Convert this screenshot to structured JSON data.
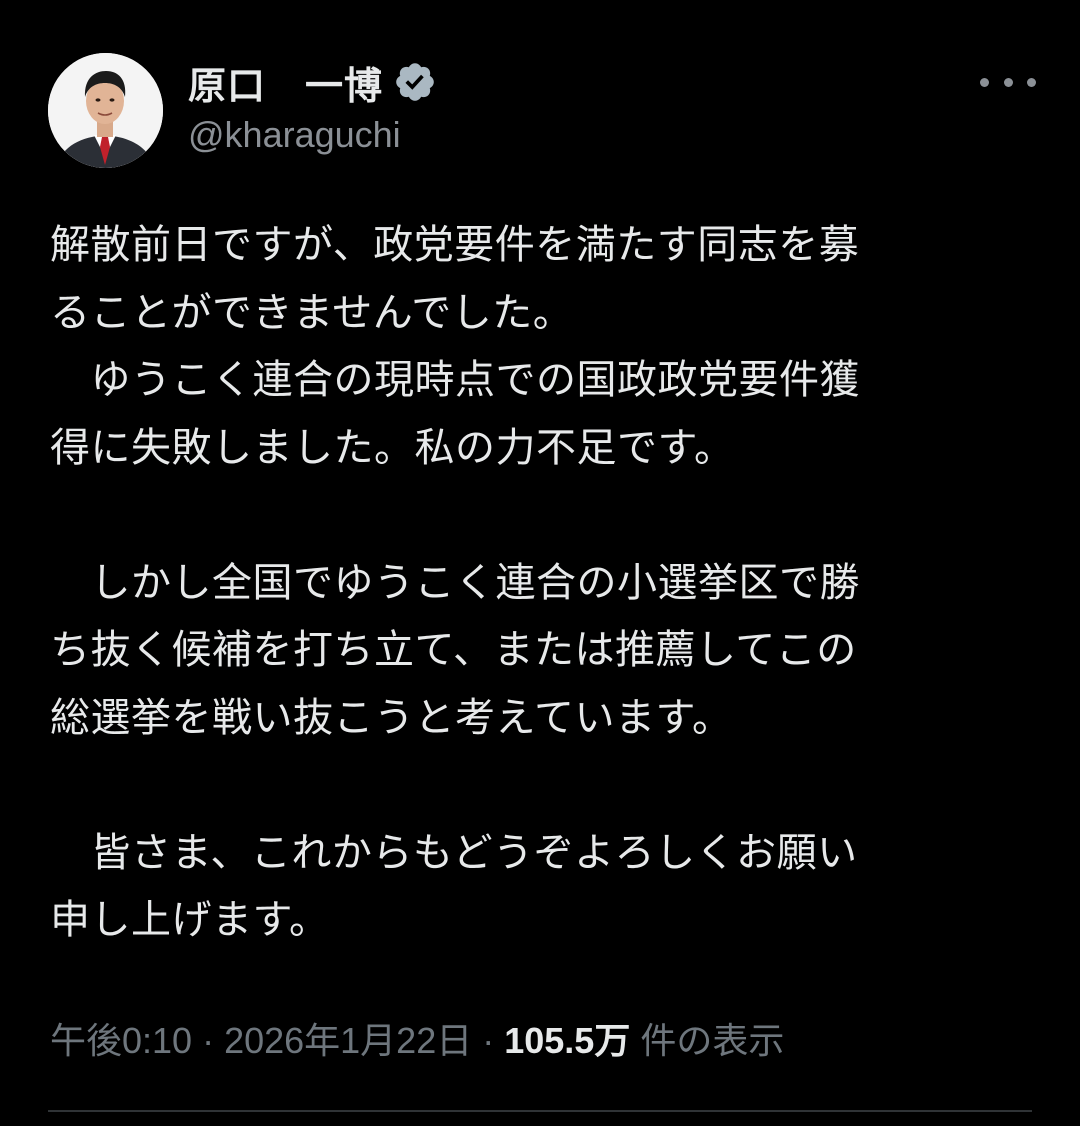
{
  "author": {
    "display_name": "原口　一博",
    "handle": "@kharaguchi",
    "verified": true,
    "verified_color": "#aab8c2"
  },
  "tweet": {
    "lines": [
      "解散前日ですが、政党要件を満たす同志を募",
      "ることができませんでした。",
      "　ゆうこく連合の現時点での国政政党要件獲",
      "得に失敗しました。私の力不足です。",
      "",
      "　しかし全国でゆうこく連合の小選挙区で勝",
      "ち抜く候補を打ち立て、または推薦してこの",
      "総選挙を戦い抜こうと考えています。",
      "",
      "　皆さま、これからもどうぞよろしくお願い",
      "申し上げます。"
    ]
  },
  "meta": {
    "time": "午後0:10",
    "separator": " · ",
    "date": "2026年1月22日",
    "views_count": "105.5万",
    "views_label": " 件の表示"
  },
  "icons": {
    "more": "more-horizontal-icon",
    "verified": "verified-badge-icon",
    "avatar": "avatar-photo"
  },
  "colors": {
    "background": "#000000",
    "text": "#e7e9ea",
    "secondary": "#6e767d",
    "divider": "#2f3336"
  }
}
